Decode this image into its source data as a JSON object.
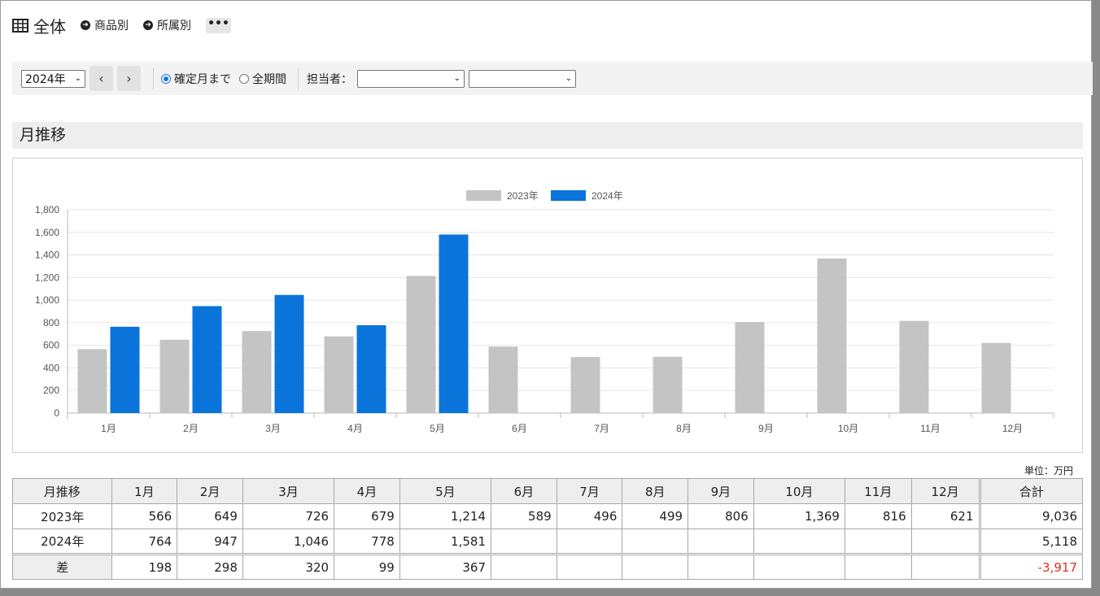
{
  "header": {
    "title": "全体",
    "nav_links": [
      "商品別",
      "所属別"
    ],
    "more_label": "•••"
  },
  "toolbar": {
    "year_select": "2024年",
    "prev_label": "‹",
    "next_label": "›",
    "radio_options": [
      {
        "label": "確定月まで",
        "checked": true
      },
      {
        "label": "全期間",
        "checked": false
      }
    ],
    "tantou_label": "担当者：",
    "select1_value": "",
    "select2_value": ""
  },
  "section": {
    "title": "月推移"
  },
  "chart_data": {
    "type": "bar",
    "categories": [
      "1月",
      "2月",
      "3月",
      "4月",
      "5月",
      "6月",
      "7月",
      "8月",
      "9月",
      "10月",
      "11月",
      "12月"
    ],
    "series": [
      {
        "name": "2023年",
        "color": "#c4c4c4",
        "values": [
          566,
          649,
          726,
          679,
          1214,
          589,
          496,
          499,
          806,
          1369,
          816,
          621
        ]
      },
      {
        "name": "2024年",
        "color": "#0a74da",
        "values": [
          764,
          947,
          1046,
          778,
          1581,
          null,
          null,
          null,
          null,
          null,
          null,
          null
        ]
      }
    ],
    "ylim": [
      0,
      1800
    ],
    "yticks": [
      "0",
      "200",
      "400",
      "600",
      "800",
      "1,000",
      "1,200",
      "1,400",
      "1,600",
      "1,800"
    ],
    "grid": true,
    "legend": "top-center"
  },
  "unit_label": "単位：万円",
  "table": {
    "headers": [
      "月推移",
      "1月",
      "2月",
      "3月",
      "4月",
      "5月",
      "6月",
      "7月",
      "8月",
      "9月",
      "10月",
      "11月",
      "12月",
      "合計"
    ],
    "rows": [
      {
        "label": "2023年",
        "cells": [
          "566",
          "649",
          "726",
          "679",
          "1,214",
          "589",
          "496",
          "499",
          "806",
          "1,369",
          "816",
          "621"
        ],
        "total": "9,036"
      },
      {
        "label": "2024年",
        "cells": [
          "764",
          "947",
          "1,046",
          "778",
          "1,581",
          "",
          "",
          "",
          "",
          "",
          "",
          ""
        ],
        "total": "5,118"
      },
      {
        "label": "差",
        "cells": [
          "198",
          "298",
          "320",
          "99",
          "367",
          "",
          "",
          "",
          "",
          "",
          "",
          ""
        ],
        "total": "-3,917"
      }
    ]
  }
}
